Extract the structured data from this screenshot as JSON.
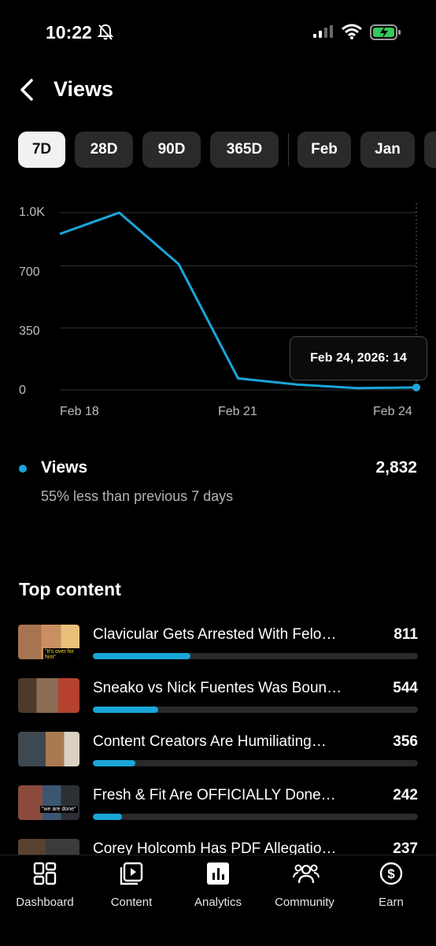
{
  "status": {
    "time": "10:22"
  },
  "header": {
    "title": "Views"
  },
  "tabs": [
    {
      "label": "7D",
      "active": true
    },
    {
      "label": "28D"
    },
    {
      "label": "90D"
    },
    {
      "label": "365D"
    },
    {
      "label": "Feb"
    },
    {
      "label": "Jan"
    }
  ],
  "chart_data": {
    "type": "line",
    "x": [
      "Feb 18",
      "Feb 19",
      "Feb 20",
      "Feb 21",
      "Feb 22",
      "Feb 23",
      "Feb 24"
    ],
    "series": [
      {
        "values": [
          880,
          1000,
          710,
          65,
          30,
          10,
          14
        ]
      }
    ],
    "yticks": [
      "1.0K",
      "700",
      "350",
      "0"
    ],
    "xticks": [
      "Feb 18",
      "Feb 21",
      "Feb 24"
    ],
    "ylim": [
      0,
      1000
    ],
    "grid": true,
    "tooltip": "Feb 24, 2026: 14"
  },
  "summary": {
    "label": "Views",
    "total": "2,832",
    "comparison": "55% less than previous 7 days"
  },
  "top_content": {
    "title": "Top content",
    "items": [
      {
        "title": "Clavicular Gets Arrested With Felo…",
        "count": "811",
        "fraction": 0.3
      },
      {
        "title": "Sneako vs Nick Fuentes Was Boun…",
        "count": "544",
        "fraction": 0.2
      },
      {
        "title": "Content Creators Are Humiliating…",
        "count": "356",
        "fraction": 0.13
      },
      {
        "title": "Fresh & Fit Are OFFICIALLY Done…",
        "count": "242",
        "fraction": 0.09
      },
      {
        "title": "Corey Holcomb Has PDF Allegatio…",
        "count": "237",
        "fraction": 0.09
      }
    ],
    "thumb_captions": [
      "\"It's over for him\"",
      "",
      "",
      "\"we are done\"",
      ""
    ]
  },
  "nav": [
    {
      "label": "Dashboard",
      "icon": "dashboard-icon"
    },
    {
      "label": "Content",
      "icon": "content-icon"
    },
    {
      "label": "Analytics",
      "icon": "analytics-icon"
    },
    {
      "label": "Community",
      "icon": "community-icon"
    },
    {
      "label": "Earn",
      "icon": "earn-icon"
    }
  ],
  "colors": {
    "accent": "#1aa6d9",
    "background": "#000000"
  }
}
